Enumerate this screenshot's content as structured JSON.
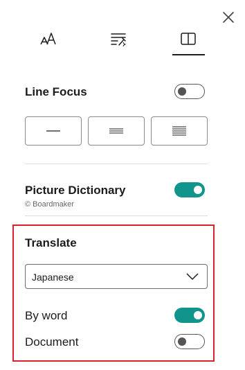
{
  "tabs": [
    {
      "icon": "text-size-icon"
    },
    {
      "icon": "text-format-icon"
    },
    {
      "icon": "reading-preferences-icon",
      "selected": true
    }
  ],
  "line_focus": {
    "title": "Line Focus",
    "enabled": false,
    "options": [
      "one-line",
      "three-lines",
      "five-lines"
    ]
  },
  "picture_dictionary": {
    "title": "Picture Dictionary",
    "credit": "© Boardmaker",
    "enabled": true
  },
  "translate": {
    "title": "Translate",
    "language": "Japanese",
    "by_word": {
      "label": "By word",
      "enabled": true
    },
    "document": {
      "label": "Document",
      "enabled": false
    }
  },
  "colors": {
    "accent": "#11948b",
    "highlight_border": "#d9202a"
  }
}
